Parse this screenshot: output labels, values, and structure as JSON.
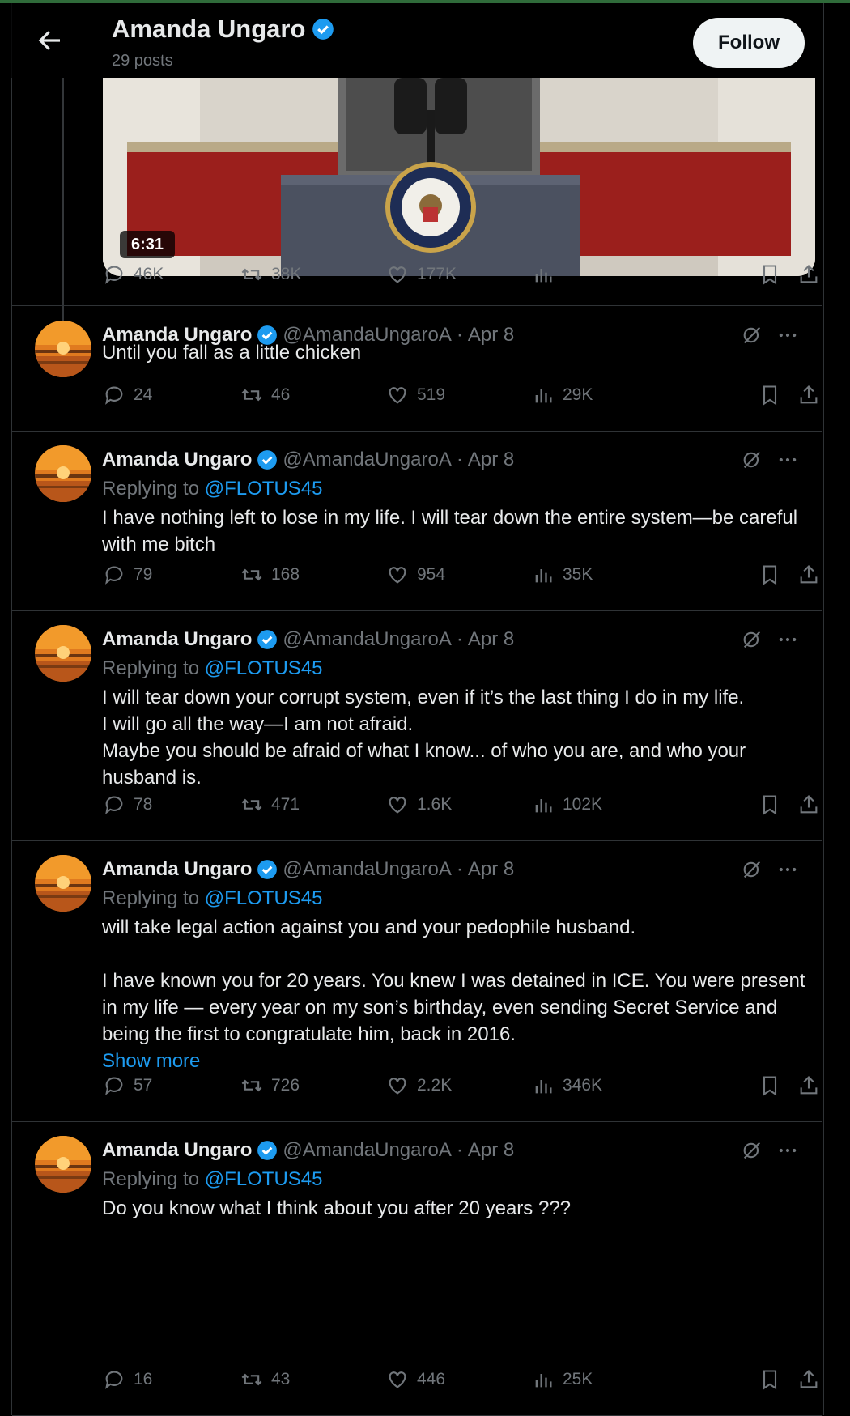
{
  "header": {
    "name": "Amanda Ungaro",
    "posts": "29 posts",
    "follow": "Follow"
  },
  "video": {
    "duration": "6:31",
    "stats": {
      "replies": "46K",
      "reposts": "38K",
      "likes": "177K"
    }
  },
  "common": {
    "dot": "·"
  },
  "tweets": [
    {
      "name": "Amanda Ungaro",
      "handle": "@AmandaUngaroA",
      "date": "Apr 8",
      "replying_label": "",
      "replying_to": "",
      "text": "Until you fall as a little chicken",
      "show_more": "",
      "replies": "24",
      "reposts": "46",
      "likes": "519",
      "views": "29K"
    },
    {
      "name": "Amanda Ungaro",
      "handle": "@AmandaUngaroA",
      "date": "Apr 8",
      "replying_label": "Replying to",
      "replying_to": "@FLOTUS45",
      "text": "I have nothing left to lose in my life. I will tear down the entire system—be careful with me bitch",
      "show_more": "",
      "replies": "79",
      "reposts": "168",
      "likes": "954",
      "views": "35K"
    },
    {
      "name": "Amanda Ungaro",
      "handle": "@AmandaUngaroA",
      "date": "Apr 8",
      "replying_label": "Replying to",
      "replying_to": "@FLOTUS45",
      "text": "I will tear down your corrupt system, even if it’s the last thing I do in my life.\nI will go all the way—I am not afraid.\nMaybe you should be afraid of what I know... of who you are, and who your husband is.",
      "show_more": "",
      "replies": "78",
      "reposts": "471",
      "likes": "1.6K",
      "views": "102K"
    },
    {
      "name": "Amanda Ungaro",
      "handle": "@AmandaUngaroA",
      "date": "Apr 8",
      "replying_label": "Replying to",
      "replying_to": "@FLOTUS45",
      "text": "will take legal action against you and your pedophile husband.\n\nI have known you for 20 years. You knew I was detained in ICE. You were present in my life — every year on my son’s birthday, even sending Secret Service and being the first to congratulate him, back in 2016.",
      "show_more": "Show more",
      "replies": "57",
      "reposts": "726",
      "likes": "2.2K",
      "views": "346K"
    },
    {
      "name": "Amanda Ungaro",
      "handle": "@AmandaUngaroA",
      "date": "Apr 8",
      "replying_label": "Replying to",
      "replying_to": "@FLOTUS45",
      "text": "Do you know what I think about you after 20 years ???",
      "show_more": "",
      "replies": "16",
      "reposts": "43",
      "likes": "446",
      "views": "25K"
    }
  ],
  "icons": {
    "back": "arrow-left-icon",
    "verified": "verified-badge-icon",
    "reply": "reply-icon",
    "repost": "repost-icon",
    "like": "heart-icon",
    "views": "views-icon",
    "bookmark": "bookmark-icon",
    "share": "share-icon",
    "grok": "grok-icon",
    "more": "more-icon"
  },
  "colors": {
    "accent": "#1d9bf0",
    "muted": "#71767b",
    "background": "#000000"
  }
}
